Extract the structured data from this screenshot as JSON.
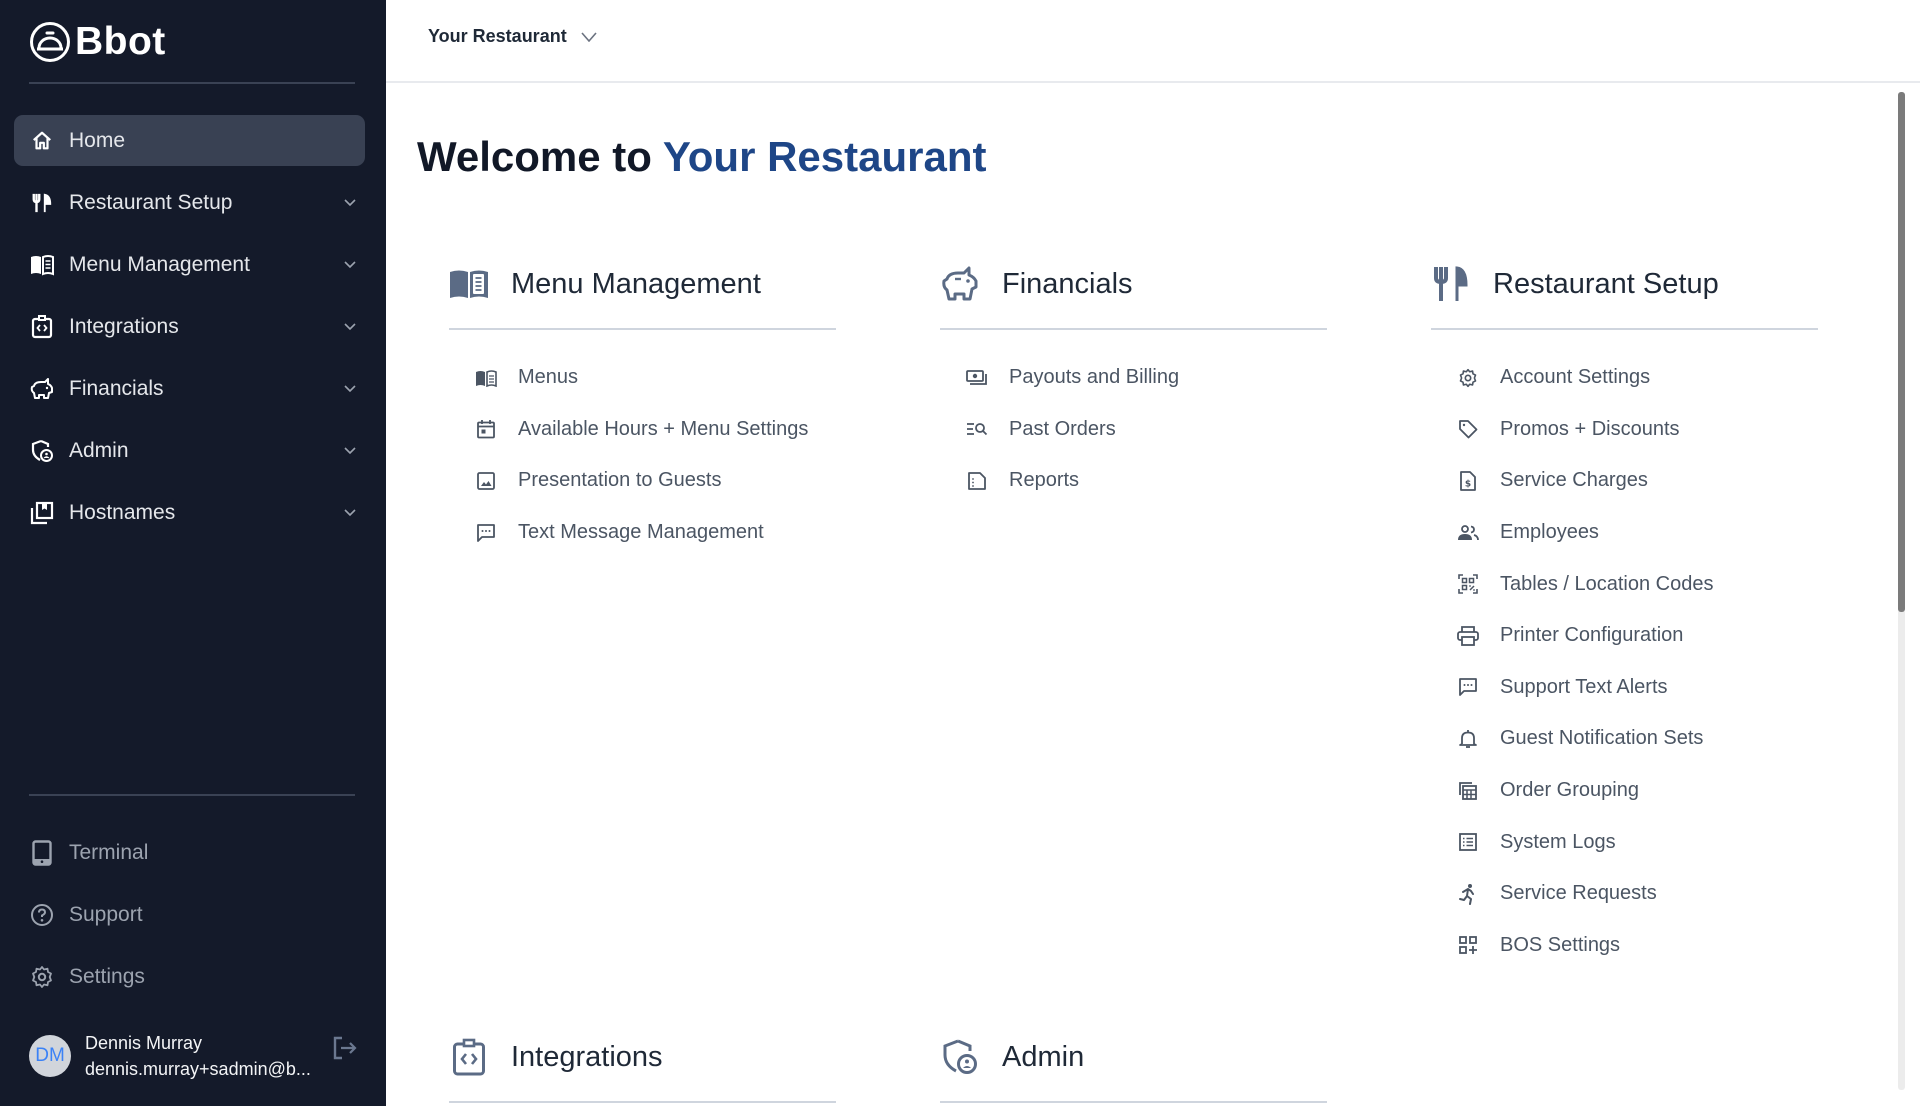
{
  "app": {
    "logo_text": "Bbot"
  },
  "sidebar": {
    "nav": [
      {
        "label": "Home",
        "icon": "home-icon",
        "active": true,
        "expandable": false
      },
      {
        "label": "Restaurant Setup",
        "icon": "utensils-icon",
        "active": false,
        "expandable": true
      },
      {
        "label": "Menu Management",
        "icon": "menu-book-icon",
        "active": false,
        "expandable": true
      },
      {
        "label": "Integrations",
        "icon": "integration-clipboard-icon",
        "active": false,
        "expandable": true
      },
      {
        "label": "Financials",
        "icon": "piggy-bank-icon",
        "active": false,
        "expandable": true
      },
      {
        "label": "Admin",
        "icon": "admin-shield-icon",
        "active": false,
        "expandable": true
      },
      {
        "label": "Hostnames",
        "icon": "hostnames-icon",
        "active": false,
        "expandable": true
      }
    ],
    "bottom": [
      {
        "label": "Terminal",
        "icon": "tablet-icon"
      },
      {
        "label": "Support",
        "icon": "help-circle-icon"
      },
      {
        "label": "Settings",
        "icon": "gear-icon"
      }
    ],
    "user": {
      "initials": "DM",
      "name": "Dennis Murray",
      "email": "dennis.murray+sadmin@b..."
    }
  },
  "topbar": {
    "restaurant_selector": "Your Restaurant"
  },
  "main": {
    "welcome_prefix": "Welcome to ",
    "welcome_name": "Your Restaurant",
    "sections": [
      {
        "title": "Menu Management",
        "icon": "menu-book-icon",
        "items": [
          {
            "label": "Menus",
            "icon": "menu-book-icon"
          },
          {
            "label": "Available Hours + Menu Settings",
            "icon": "calendar-icon"
          },
          {
            "label": "Presentation to Guests",
            "icon": "image-icon"
          },
          {
            "label": "Text Message Management",
            "icon": "chat-icon"
          }
        ]
      },
      {
        "title": "Financials",
        "icon": "piggy-bank-icon",
        "items": [
          {
            "label": "Payouts and Billing",
            "icon": "payments-icon"
          },
          {
            "label": "Past Orders",
            "icon": "list-search-icon"
          },
          {
            "label": "Reports",
            "icon": "report-icon"
          }
        ]
      },
      {
        "title": "Restaurant Setup",
        "icon": "utensils-icon",
        "items": [
          {
            "label": "Account Settings",
            "icon": "gear-icon"
          },
          {
            "label": "Promos + Discounts",
            "icon": "tag-icon"
          },
          {
            "label": "Service Charges",
            "icon": "dollar-file-icon"
          },
          {
            "label": "Employees",
            "icon": "people-icon"
          },
          {
            "label": "Tables / Location Codes",
            "icon": "qr-code-icon"
          },
          {
            "label": "Printer Configuration",
            "icon": "printer-icon"
          },
          {
            "label": "Support Text Alerts",
            "icon": "chat-icon"
          },
          {
            "label": "Guest Notification Sets",
            "icon": "bell-icon"
          },
          {
            "label": "Order Grouping",
            "icon": "order-grouping-icon"
          },
          {
            "label": "System Logs",
            "icon": "list-icon"
          },
          {
            "label": "Service Requests",
            "icon": "running-person-icon"
          },
          {
            "label": "BOS Settings",
            "icon": "grid-plus-icon"
          }
        ]
      },
      {
        "title": "Integrations",
        "icon": "integration-clipboard-icon",
        "items": []
      },
      {
        "title": "Admin",
        "icon": "admin-shield-icon",
        "items": []
      }
    ]
  },
  "colors": {
    "sidebar_bg": "#141a2a",
    "sidebar_active": "#394153",
    "accent": "#1e4687",
    "icon_gray": "#5b6b85"
  }
}
